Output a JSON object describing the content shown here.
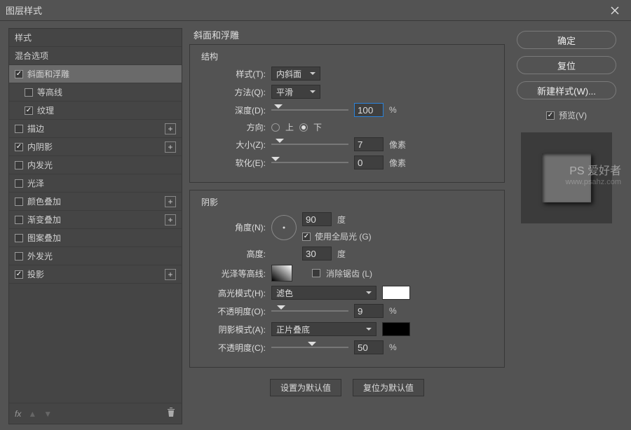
{
  "title": "图层样式",
  "sidebar": {
    "items": [
      {
        "label": "样式",
        "check": null
      },
      {
        "label": "混合选项",
        "check": null
      },
      {
        "label": "斜面和浮雕",
        "check": true,
        "selected": true
      },
      {
        "label": "等高线",
        "check": false,
        "sub": true
      },
      {
        "label": "纹理",
        "check": true,
        "sub": true
      },
      {
        "label": "描边",
        "check": false,
        "plus": true
      },
      {
        "label": "内阴影",
        "check": true,
        "plus": true
      },
      {
        "label": "内发光",
        "check": false
      },
      {
        "label": "光泽",
        "check": false
      },
      {
        "label": "颜色叠加",
        "check": false,
        "plus": true
      },
      {
        "label": "渐变叠加",
        "check": false,
        "plus": true
      },
      {
        "label": "图案叠加",
        "check": false
      },
      {
        "label": "外发光",
        "check": false
      },
      {
        "label": "投影",
        "check": true,
        "plus": true
      }
    ],
    "fx_label": "fx"
  },
  "settings": {
    "title": "斜面和浮雕",
    "structure": {
      "group_label": "结构",
      "style_label": "样式(T):",
      "style_value": "内斜面",
      "technique_label": "方法(Q):",
      "technique_value": "平滑",
      "depth_label": "深度(D):",
      "depth_value": "100",
      "depth_unit": "%",
      "direction_label": "方向:",
      "direction_up": "上",
      "direction_down": "下",
      "size_label": "大小(Z):",
      "size_value": "7",
      "size_unit": "像素",
      "soften_label": "软化(E):",
      "soften_value": "0",
      "soften_unit": "像素"
    },
    "shading": {
      "group_label": "阴影",
      "angle_label": "角度(N):",
      "angle_value": "90",
      "angle_unit": "度",
      "global_light_label": "使用全局光 (G)",
      "altitude_label": "高度:",
      "altitude_value": "30",
      "altitude_unit": "度",
      "gloss_contour_label": "光泽等高线:",
      "antialias_label": "消除锯齿 (L)",
      "highlight_mode_label": "高光模式(H):",
      "highlight_mode_value": "滤色",
      "highlight_opacity_label": "不透明度(O):",
      "highlight_opacity_value": "9",
      "highlight_opacity_unit": "%",
      "shadow_mode_label": "阴影模式(A):",
      "shadow_mode_value": "正片叠底",
      "shadow_opacity_label": "不透明度(C):",
      "shadow_opacity_value": "50",
      "shadow_opacity_unit": "%"
    },
    "defaults": {
      "make_default": "设置为默认值",
      "reset_default": "复位为默认值"
    }
  },
  "right": {
    "ok": "确定",
    "reset": "复位",
    "new_style": "新建样式(W)...",
    "preview": "预览(V)"
  },
  "watermark": {
    "brand": "PS 爱好者",
    "url": "www.psahz.com"
  }
}
